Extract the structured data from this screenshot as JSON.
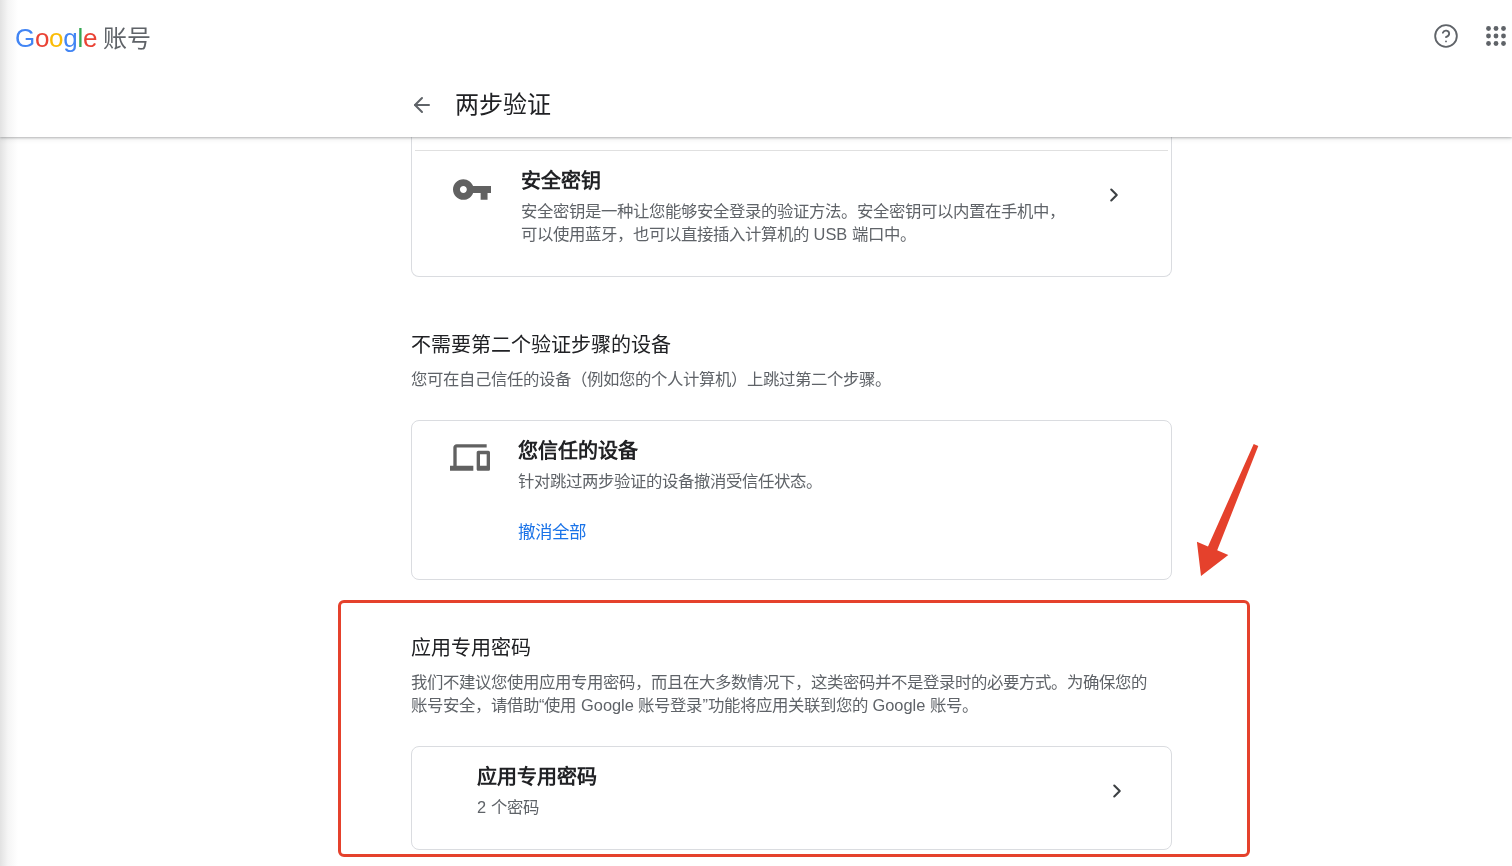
{
  "header": {
    "logo": {
      "brand": "Google",
      "product": "账号"
    },
    "title": "两步验证"
  },
  "sections": [
    {
      "kind": "methods",
      "cards": [
        {
          "kind": "security_key",
          "title": "安全密钥",
          "description": "安全密钥是一种让您能够安全登录的验证方法。安全密钥可以内置在手机中，可以使用蓝牙，也可以直接插入计算机的 USB 端口中。"
        }
      ]
    },
    {
      "kind": "trusted",
      "title": "不需要第二个验证步骤的设备",
      "description": "您可在自己信任的设备（例如您的个人计算机）上跳过第二个步骤。",
      "cards": [
        {
          "kind": "trusted_devices",
          "title": "您信任的设备",
          "description": "针对跳过两步验证的设备撤消受信任状态。",
          "link": "撤消全部"
        }
      ]
    },
    {
      "kind": "app_passwords",
      "title": "应用专用密码",
      "description": "我们不建议您使用应用专用密码，而且在大多数情况下，这类密码并不是登录时的必要方式。为确保您的账号安全，请借助“使用 Google 账号登录”功能将应用关联到您的 Google 账号。",
      "highlighted": true,
      "cards": [
        {
          "kind": "app_passwords",
          "title": "应用专用密码",
          "description": "2 个密码"
        }
      ]
    }
  ]
}
